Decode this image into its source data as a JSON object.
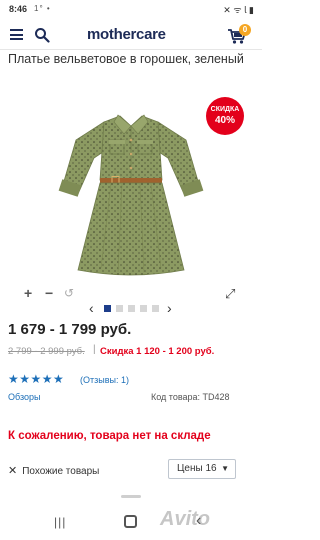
{
  "status_bar": {
    "time": "8:46",
    "left_icons": "1° •",
    "right_icons": "✕ ᯤ 𝗅 ▮"
  },
  "header": {
    "logo": "mothercare",
    "cart_count": "0",
    "icons": [
      "menu-icon",
      "search-icon",
      "cart-icon"
    ]
  },
  "product": {
    "title": "Платье вельветовое в горошек, зеленый",
    "promo_line1": "СКИДКА",
    "promo_line2": "40%",
    "price": "1 679 - 1 799 руб.",
    "old_price": "2 799 - 2 999 руб.",
    "discount_separator": "|",
    "discount_text": "Скидка 1 120 - 1 200 руб.",
    "stars": "★★★★★",
    "rating_value": 5,
    "reviews": "(Отзывы: 1)",
    "overviews_link": "Обзоры",
    "sku": "Код товара: TD428",
    "out_of_stock": "К сожалению, товара нет на складе"
  },
  "gallery": {
    "zoom_in": "+",
    "zoom_out": "−",
    "rotate": "↺",
    "fullscreen": "⤢",
    "prev": "‹",
    "next": "›",
    "active_index": 0,
    "count": 5
  },
  "bottom_bar": {
    "close": "✕",
    "similar": "Похожие товары",
    "prices_label": "Цены 16",
    "prices_arrow": "▼"
  },
  "system_nav": {
    "recent": "|||",
    "back": "‹",
    "watermark": "Avito"
  },
  "colors": {
    "brand": "#1d2b57",
    "accent_red": "#e3001b",
    "link_blue": "#1d6fb8",
    "badge_orange": "#f5a623",
    "dress_green": "#8c9a62"
  }
}
